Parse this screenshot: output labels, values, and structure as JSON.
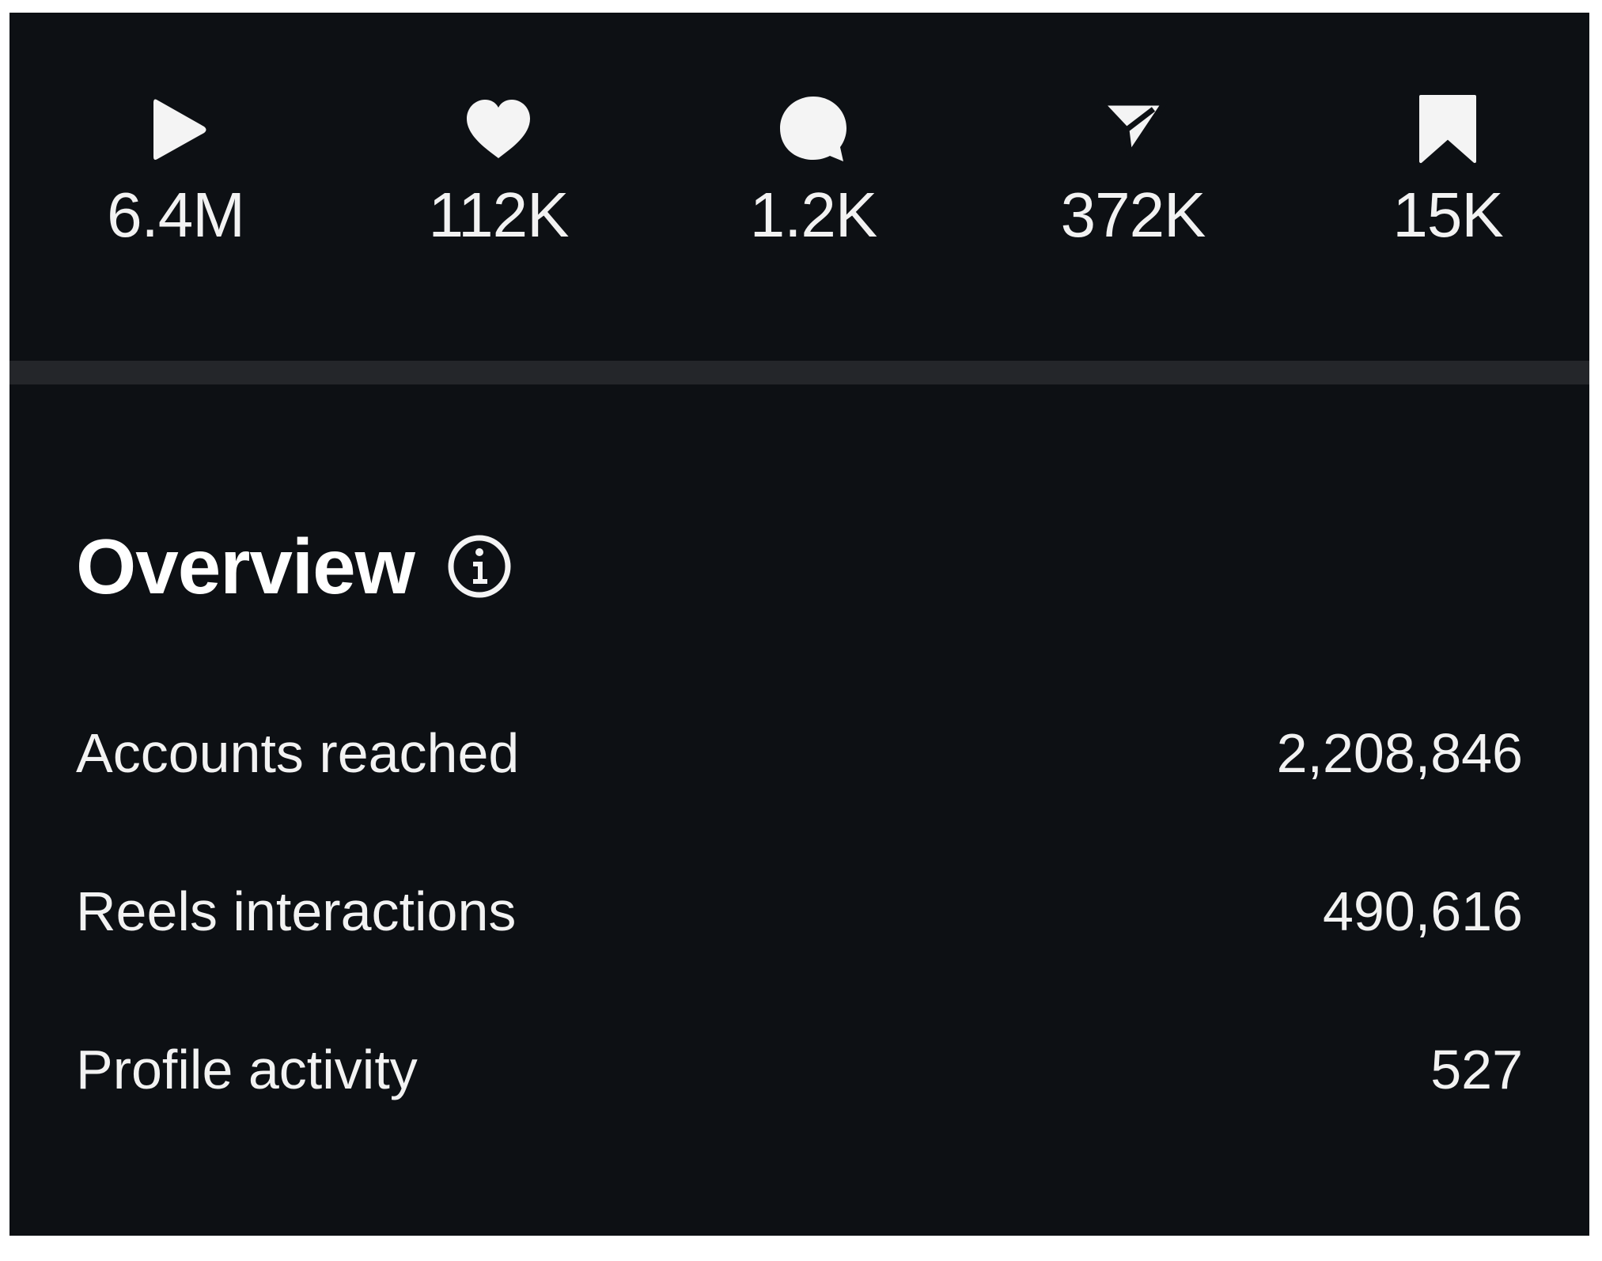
{
  "colors": {
    "background": "#0d1014",
    "divider": "#24262a",
    "text": "#f2f2f2"
  },
  "stats": [
    {
      "icon": "play-icon",
      "value": "6.4M"
    },
    {
      "icon": "heart-icon",
      "value": "112K"
    },
    {
      "icon": "comment-icon",
      "value": "1.2K"
    },
    {
      "icon": "share-icon",
      "value": "372K"
    },
    {
      "icon": "bookmark-icon",
      "value": "15K"
    }
  ],
  "overview": {
    "title": "Overview",
    "info_icon": "info-icon",
    "rows": [
      {
        "label": "Accounts reached",
        "value": "2,208,846"
      },
      {
        "label": "Reels interactions",
        "value": "490,616"
      },
      {
        "label": "Profile activity",
        "value": "527"
      }
    ]
  }
}
